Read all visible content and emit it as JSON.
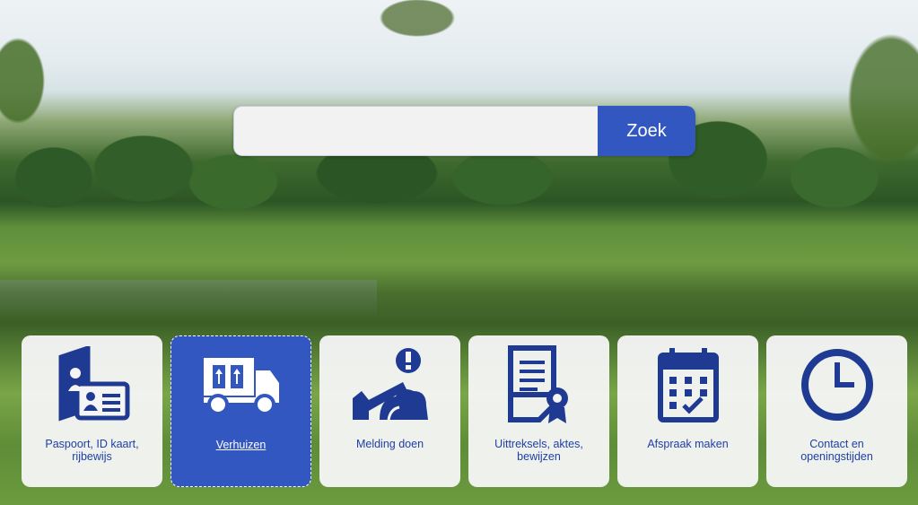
{
  "search": {
    "value": "",
    "placeholder": "",
    "button_label": "Zoek"
  },
  "tiles": [
    {
      "label": "Paspoort, ID kaart, rijbewijs",
      "icon": "passport-id-icon",
      "active": false
    },
    {
      "label": "Verhuizen",
      "icon": "moving-truck-icon",
      "active": true
    },
    {
      "label": "Melding doen",
      "icon": "report-fallen-tree-icon",
      "active": false
    },
    {
      "label": "Uittreksels, aktes, bewijzen",
      "icon": "certificate-document-icon",
      "active": false
    },
    {
      "label": "Afspraak maken",
      "icon": "calendar-icon",
      "active": false
    },
    {
      "label": "Contact en openingstijden",
      "icon": "clock-icon",
      "active": false
    }
  ],
  "colors": {
    "brand_blue": "#3357c1",
    "icon_blue": "#1f3a93",
    "tile_bg": "#f5f5f5"
  }
}
